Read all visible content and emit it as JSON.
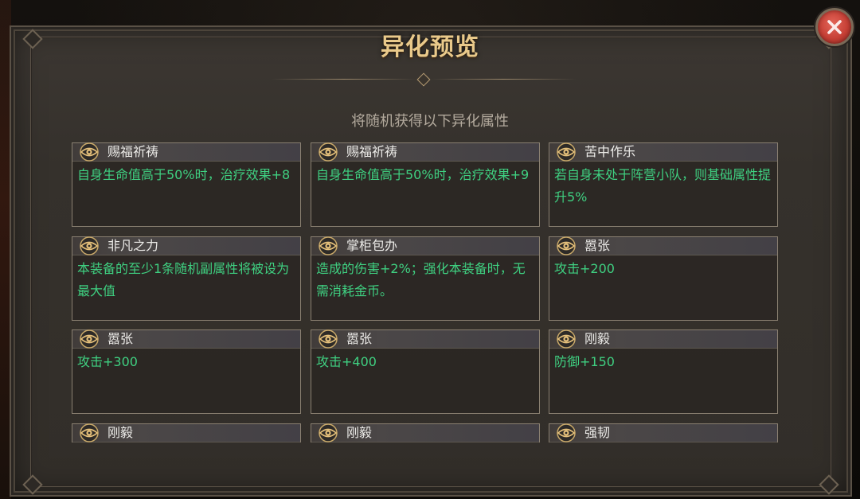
{
  "dialog": {
    "title": "异化预览",
    "subtitle": "将随机获得以下异化属性",
    "close_icon": "close-x-icon"
  },
  "cards": [
    {
      "name": "赐福祈祷",
      "desc": "自身生命值高于50%时，治疗效果+8",
      "icon": "eye-icon"
    },
    {
      "name": "赐福祈祷",
      "desc": "自身生命值高于50%时，治疗效果+9",
      "icon": "eye-icon"
    },
    {
      "name": "苦中作乐",
      "desc": "若自身未处于阵营小队，则基础属性提升5%",
      "icon": "eye-icon"
    },
    {
      "name": "非凡之力",
      "desc": "本装备的至少1条随机副属性将被设为最大值",
      "icon": "eye-icon"
    },
    {
      "name": "掌柜包办",
      "desc": "造成的伤害+2%；强化本装备时，无需消耗金币。",
      "icon": "eye-icon"
    },
    {
      "name": "嚣张",
      "desc": "攻击+200",
      "icon": "eye-icon"
    },
    {
      "name": "嚣张",
      "desc": "攻击+300",
      "icon": "eye-icon"
    },
    {
      "name": "嚣张",
      "desc": "攻击+400",
      "icon": "eye-icon"
    },
    {
      "name": "刚毅",
      "desc": "防御+150",
      "icon": "eye-icon"
    },
    {
      "name": "刚毅",
      "desc": "",
      "icon": "eye-icon"
    },
    {
      "name": "刚毅",
      "desc": "",
      "icon": "eye-icon"
    },
    {
      "name": "强韧",
      "desc": "",
      "icon": "eye-icon"
    }
  ],
  "colors": {
    "title": "#e9c98a",
    "subtitle": "#b3aa9d",
    "card_name": "#ecebe8",
    "card_desc": "#3fd081",
    "close_button": "#c63f35"
  }
}
